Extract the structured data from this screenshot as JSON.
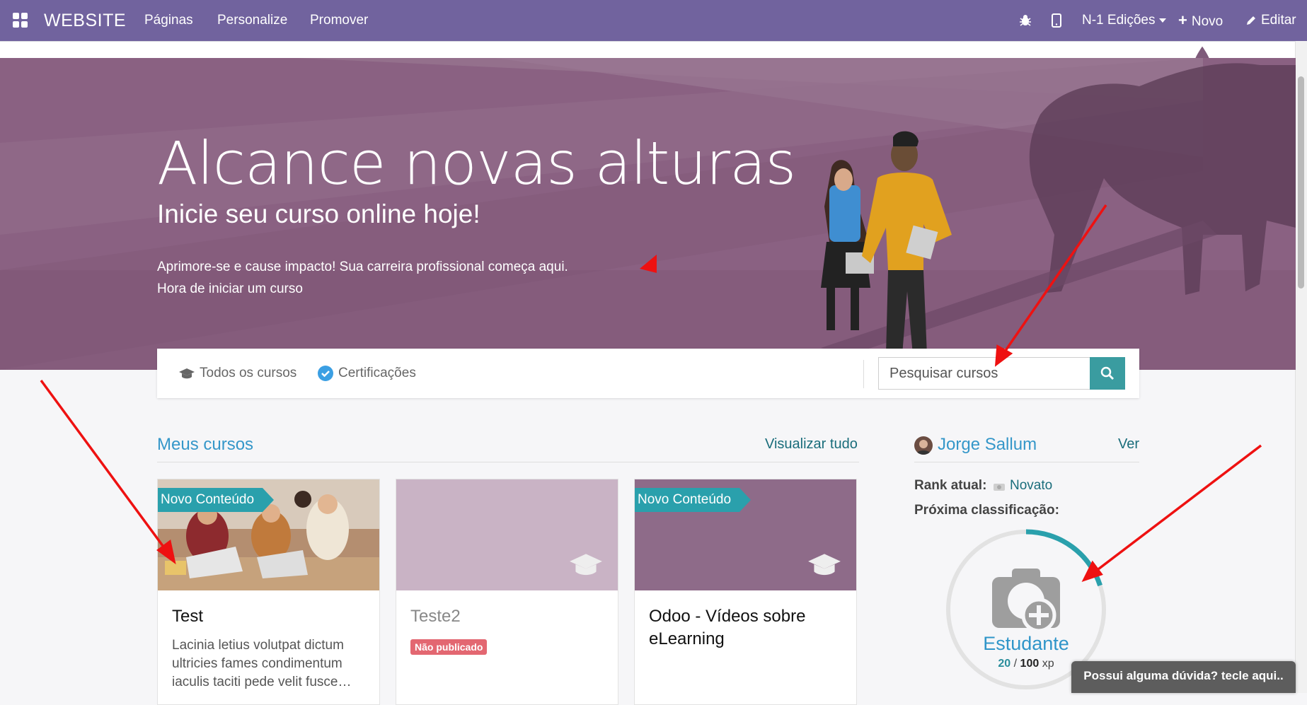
{
  "topbar": {
    "brand": "WEBSITE",
    "menu": [
      "Páginas",
      "Personalize",
      "Promover"
    ],
    "version_label": "N-1 Edições",
    "new_label": "Novo",
    "edit_label": "Editar"
  },
  "hero": {
    "title": "Alcance novas alturas",
    "subtitle": "Inicie seu curso online hoje!",
    "line1": "Aprimore-se e cause impacto! Sua carreira profissional começa aqui.",
    "line2": "Hora de iniciar um curso"
  },
  "filters": {
    "all_courses": "Todos os cursos",
    "certifications": "Certificações",
    "search_placeholder": "Pesquisar cursos"
  },
  "my_courses": {
    "title": "Meus cursos",
    "view_all": "Visualizar tudo",
    "cards": [
      {
        "title": "Test",
        "ribbon": "Novo Conteúdo",
        "description": "Lacinia letius volutpat dictum ultricies fames condimentum iaculis taciti pede velit fusce…"
      },
      {
        "title": "Teste2",
        "badge": "Não publicado"
      },
      {
        "title": "Odoo - Vídeos sobre eLearning",
        "ribbon": "Novo Conteúdo"
      }
    ]
  },
  "profile": {
    "name": "Jorge Sallum",
    "view": "Ver",
    "rank_label": "Rank atual:",
    "rank_value": "Novato",
    "next_label": "Próxima classificação:",
    "next_rank": "Estudante",
    "xp_current": "20",
    "xp_sep": "/",
    "xp_total": "100",
    "xp_unit": "xp",
    "progress": 0.2
  },
  "help_button": "Possui alguma dúvida? tecle aqui..",
  "colors": {
    "navbar": "#71639e",
    "hero": "#8a6182",
    "accent": "#3a9ca0",
    "link": "#3597c9",
    "unpublished": "#e36771"
  }
}
